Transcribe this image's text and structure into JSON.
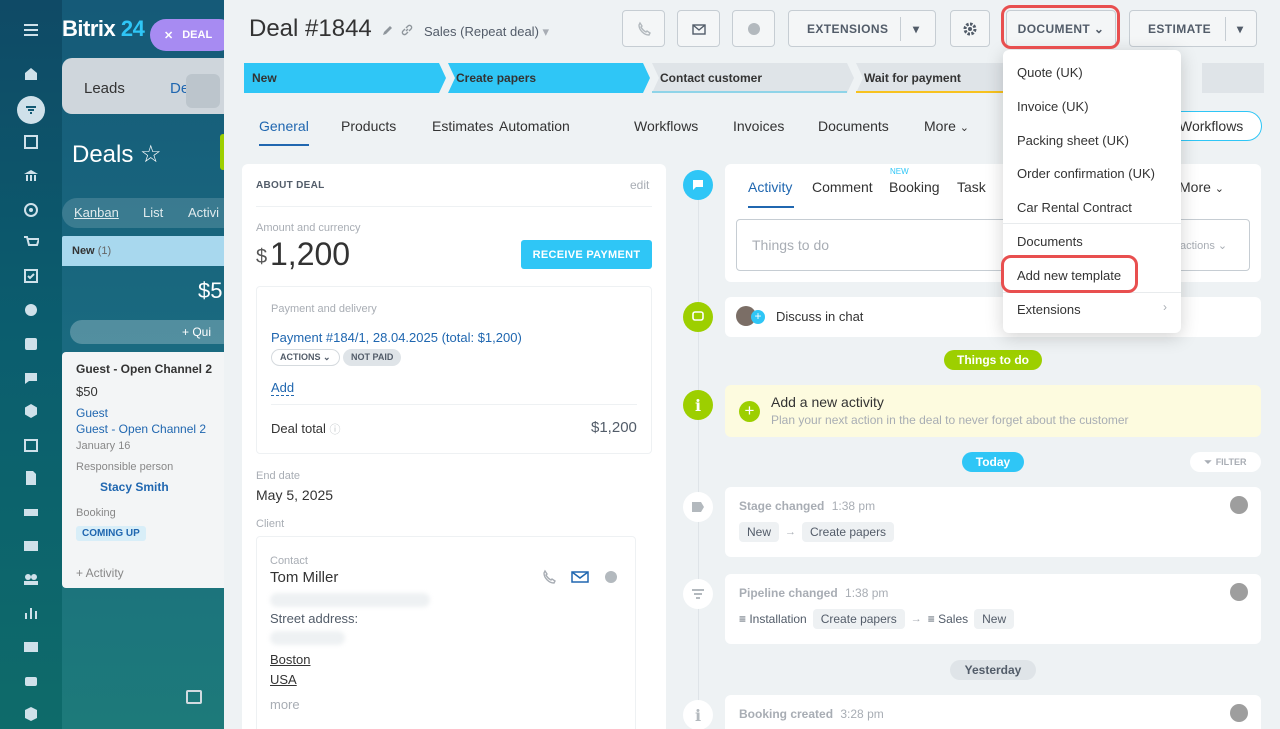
{
  "rail": {
    "icons": [
      "menu-icon",
      "home-icon",
      "filter-icon",
      "tasks-icon",
      "bank-icon",
      "target-icon",
      "cart-icon",
      "checkbox-icon",
      "pie-icon",
      "inbox-icon",
      "chat-icon",
      "hexagon-icon",
      "calendar-icon",
      "document-icon",
      "print-icon",
      "mail-icon",
      "users-icon",
      "analytics-icon",
      "contact-card-icon",
      "robot-icon",
      "box-icon"
    ]
  },
  "bg": {
    "brand_text": "Bitrix",
    "brand_num": "24",
    "deal_pill": "DEAL",
    "tab_leads": "Leads",
    "tab_deals": "De",
    "deals_title": "Deals ☆",
    "views": [
      "Kanban",
      "List",
      "Activi"
    ],
    "column": "New",
    "column_count": "(1)",
    "amount": "$5",
    "quick": "+ Qui",
    "card": {
      "title": "Guest - Open Channel 2",
      "amount": "$50",
      "client": "Guest",
      "client2": "Guest - Open Channel 2",
      "date": "January 16",
      "resp_label": "Responsible person",
      "resp": "Stacy Smith",
      "booking_label": "Booking",
      "booking": "COMING UP",
      "activity": "+ Activity"
    }
  },
  "header": {
    "title": "Deal #1844",
    "pipeline": "Sales (Repeat deal)",
    "buttons": {
      "extensions": "EXTENSIONS",
      "document": "DOCUMENT",
      "estimate": "ESTIMATE"
    }
  },
  "stages": [
    {
      "label": "New",
      "color": "#2fc6f6"
    },
    {
      "label": "Create papers",
      "color": "#2fc6f6"
    },
    {
      "label": "Contact customer",
      "color": "#dfe4e8"
    },
    {
      "label": "Wait for payment",
      "color": "#dfe4e8"
    }
  ],
  "tabs": [
    "General",
    "Products",
    "Estimates",
    "Automation",
    "Workflows",
    "Invoices",
    "Documents",
    "More"
  ],
  "workflows_btn": "Workflows",
  "about": {
    "heading": "ABOUT DEAL",
    "edit": "edit",
    "amount_label": "Amount and currency",
    "currency": "$",
    "amount": "1,200",
    "receive_btn": "RECEIVE PAYMENT",
    "payment_label": "Payment and delivery",
    "payment_link": "Payment #184/1, 28.04.2025 (total: $1,200)",
    "actions": "ACTIONS",
    "not_paid": "NOT PAID",
    "add": "Add",
    "total_label": "Deal total",
    "total_value": "$1,200",
    "end_label": "End date",
    "end_value": "May 5, 2025",
    "client_label": "Client",
    "contact_label": "Contact",
    "contact_name": "Tom Miller",
    "street_label": "Street address:",
    "city": "Boston",
    "country": "USA",
    "more": "more"
  },
  "activity": {
    "tabs": [
      "Activity",
      "Comment",
      "Booking",
      "Task"
    ],
    "new_badge": "NEW",
    "more": "More",
    "placeholder": "Things to do",
    "actions_partial": "actions",
    "discuss": "Discuss in chat",
    "things_pill": "Things to do",
    "add_title": "Add a new activity",
    "add_sub": "Plan your next action in the deal to never forget about the customer",
    "today": "Today",
    "filter": "FILTER",
    "e1": {
      "title": "Stage changed",
      "time": "1:38 pm",
      "from": "New",
      "to": "Create papers"
    },
    "e2": {
      "title": "Pipeline changed",
      "time": "1:38 pm",
      "p1": "Installation",
      "s1": "Create papers",
      "p2": "Sales",
      "s2": "New"
    },
    "yesterday": "Yesterday",
    "e3": {
      "title": "Booking created",
      "time": "3:28 pm"
    }
  },
  "dropdown": {
    "items": [
      "Quote (UK)",
      "Invoice (UK)",
      "Packing sheet (UK)",
      "Order confirmation (UK)",
      "Car Rental Contract",
      "Documents",
      "Add new template",
      "Extensions"
    ]
  },
  "colors": {
    "accent": "#2067b0",
    "cyan": "#2fc6f6",
    "green": "#9dcf00",
    "highlight": "#e84f4f"
  }
}
